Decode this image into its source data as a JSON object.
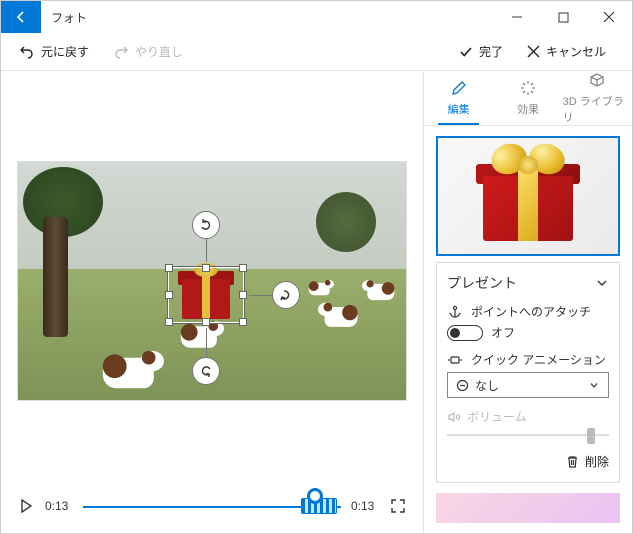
{
  "app": {
    "title": "フォト"
  },
  "toolbar": {
    "undo": "元に戻す",
    "redo": "やり直し",
    "done": "完了",
    "cancel": "キャンセル"
  },
  "timeline": {
    "current": "0:13",
    "total": "0:13"
  },
  "side": {
    "tabs": {
      "edit": "編集",
      "effects": "効果",
      "library": "3D ライブラリ"
    },
    "card": {
      "title": "プレゼント",
      "attach_label": "ポイントへのアタッチ",
      "attach_state": "オフ",
      "anim_label": "クイック アニメーション",
      "anim_value": "なし",
      "volume_label": "ボリューム",
      "delete": "削除"
    }
  },
  "icons": {
    "undo": "↶",
    "redo": "↷",
    "check": "✓",
    "close": "✕",
    "rotate_xy": "↻",
    "rotate_z": "↺",
    "tilt": "⟳",
    "anchor": "⟟",
    "sparkle": "✨",
    "minus_circle": "⊖",
    "chevron_down": "⌄",
    "trash": "🗑",
    "volume": "🔊"
  }
}
